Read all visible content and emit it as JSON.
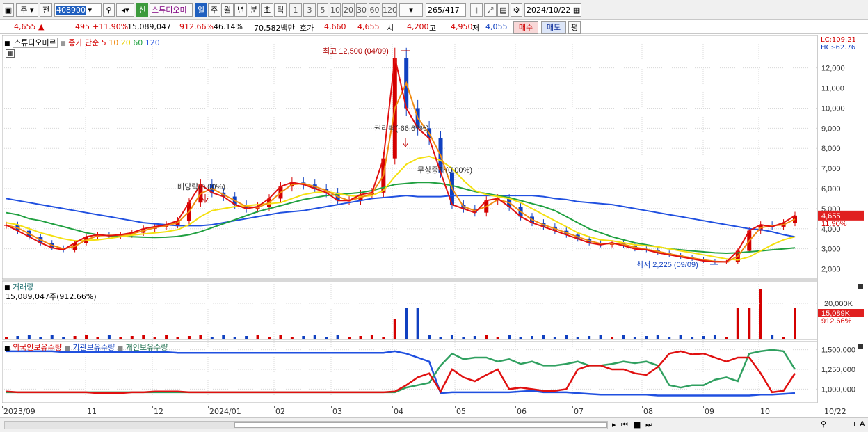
{
  "toolbar": {
    "market": "주",
    "prev": "전",
    "code": "408900",
    "badge": "신",
    "stock_name": "스튜디오미",
    "periods": [
      "일",
      "주",
      "월",
      "년",
      "분",
      "초",
      "틱"
    ],
    "selected_period": "일",
    "numbers": [
      "1",
      "3",
      "5",
      "10",
      "20",
      "30",
      "60",
      "120"
    ],
    "count": "265",
    "count_total": "/417",
    "date": "2024/10/22"
  },
  "info": {
    "price": "4,655",
    "change": "495",
    "change_pct": "+11.90%",
    "volume": "15,089,047",
    "volume_pct": "912.66%",
    "turnover": "46.14%",
    "amount": "70,582백만",
    "ask_label": "호가",
    "ask1": "4,660",
    "ask2": "4,655",
    "open_label": "시",
    "open": "4,200",
    "high_label": "고",
    "high": "4,950",
    "low_label": "저",
    "low": "4,055",
    "buy": "매수",
    "sell": "매도",
    "avg": "평"
  },
  "colors": {
    "up": "#d40000",
    "down": "#1040c0",
    "ma5": "#e01010",
    "ma10": "#f08a10",
    "ma20": "#f4e010",
    "ma60": "#20a040",
    "ma120": "#2050e0",
    "foreign": "#e01010",
    "inst": "#2050e0",
    "indiv": "#30a060"
  },
  "price_panel": {
    "name": "스튜디오미르",
    "ma_label": "종가 단순",
    "ma_periods": [
      "5",
      "10",
      "20",
      "60",
      "120"
    ],
    "lc": "LC:109.21",
    "hc": "HC:-62.76",
    "last_price_label": "4,655",
    "last_pct_label": "11.90%",
    "annotations": {
      "high": "최고 12,500 (04/09)",
      "low": "최저 2,225 (09/09)",
      "rights": "권리락(-66.67%)",
      "bonus": "무상증자(0.00%)",
      "dividend": "배당락(0.00%)"
    }
  },
  "volume_panel": {
    "title": "거래량",
    "value": "15,089,047주(912.66%)",
    "axis_label": "20,000K",
    "last_label": "15,089K",
    "last_pct": "912.66%"
  },
  "holder_panel": {
    "legend": [
      "외국인보유수량",
      "기관보유수량",
      "개인보유수량"
    ]
  },
  "x_labels": [
    "2023/09",
    "11",
    "12",
    "2024/01",
    "02",
    "03",
    "04",
    "05",
    "06",
    "07",
    "08",
    "09",
    "10",
    "10/22"
  ],
  "chart_data": {
    "type": "line",
    "y_ticks": [
      12000,
      11000,
      10000,
      9000,
      8000,
      7000,
      6000,
      5000,
      4000,
      3000,
      2000
    ],
    "ylim": [
      1500,
      13200
    ],
    "volume_ticks_label": "20,000K",
    "holder_ticks": [
      1500000,
      1250000,
      1000000
    ],
    "close": [
      4180,
      3900,
      3600,
      3300,
      3050,
      2950,
      3300,
      3600,
      3700,
      3650,
      3700,
      3800,
      4000,
      4100,
      4200,
      4400,
      5300,
      6200,
      5800,
      5600,
      5200,
      5000,
      5100,
      5500,
      6100,
      6300,
      6200,
      6000,
      5800,
      5400,
      5400,
      5700,
      5800,
      7500,
      12500,
      10000,
      9000,
      8500,
      6800,
      5200,
      5000,
      4800,
      5400,
      5500,
      5100,
      4600,
      4300,
      4100,
      3900,
      3700,
      3500,
      3300,
      3200,
      3300,
      3150,
      3000,
      2950,
      2800,
      2700,
      2600,
      2500,
      2400,
      2350,
      2350,
      2900,
      3900,
      4200,
      4100,
      4300,
      4655
    ],
    "ma20": [
      4300,
      4200,
      4000,
      3800,
      3650,
      3500,
      3400,
      3420,
      3450,
      3520,
      3600,
      3680,
      3740,
      3790,
      3850,
      3950,
      4200,
      4600,
      4900,
      5000,
      5100,
      5150,
      5200,
      5250,
      5300,
      5500,
      5700,
      5800,
      5850,
      5750,
      5650,
      5600,
      5650,
      5900,
      6600,
      7200,
      7500,
      7600,
      7400,
      7000,
      6400,
      5900,
      5700,
      5600,
      5500,
      5300,
      5000,
      4700,
      4400,
      4100,
      3800,
      3600,
      3450,
      3400,
      3300,
      3200,
      3150,
      3100,
      3000,
      2900,
      2800,
      2700,
      2600,
      2500,
      2450,
      2600,
      2900,
      3200,
      3450,
      3600
    ],
    "ma60": [
      4800,
      4700,
      4500,
      4400,
      4250,
      4100,
      3950,
      3800,
      3700,
      3650,
      3620,
      3600,
      3580,
      3570,
      3580,
      3620,
      3700,
      3850,
      4050,
      4250,
      4450,
      4650,
      4850,
      5000,
      5150,
      5300,
      5450,
      5550,
      5650,
      5700,
      5750,
      5800,
      5900,
      6050,
      6200,
      6250,
      6300,
      6300,
      6250,
      6150,
      6000,
      5850,
      5750,
      5650,
      5550,
      5400,
      5250,
      5100,
      4900,
      4600,
      4300,
      4000,
      3800,
      3600,
      3450,
      3300,
      3200,
      3100,
      3000,
      2950,
      2900,
      2850,
      2800,
      2780,
      2800,
      2850,
      2900,
      2950,
      3000,
      3050
    ],
    "ma120": [
      5500,
      5400,
      5300,
      5200,
      5100,
      5000,
      4900,
      4800,
      4700,
      4600,
      4500,
      4400,
      4300,
      4250,
      4200,
      4150,
      4150,
      4150,
      4200,
      4300,
      4400,
      4500,
      4600,
      4700,
      4800,
      4850,
      4900,
      5000,
      5100,
      5200,
      5300,
      5400,
      5500,
      5550,
      5600,
      5650,
      5600,
      5600,
      5600,
      5650,
      5650,
      5650,
      5650,
      5650,
      5650,
      5650,
      5650,
      5600,
      5500,
      5450,
      5350,
      5300,
      5250,
      5200,
      5100,
      5000,
      4900,
      4800,
      4700,
      4600,
      4500,
      4400,
      4300,
      4200,
      4100,
      4000,
      3950,
      3850,
      3700,
      3600
    ],
    "volume_spikes_idx": [
      34,
      35,
      36,
      64,
      65,
      66,
      69
    ],
    "foreign_mil": [
      0.97,
      0.96,
      0.96,
      0.96,
      0.96,
      0.96,
      0.96,
      0.96,
      0.95,
      0.95,
      0.95,
      0.96,
      0.96,
      0.97,
      0.97,
      0.97,
      0.96,
      0.96,
      0.96,
      0.96,
      0.96,
      0.96,
      0.96,
      0.96,
      0.96,
      0.96,
      0.96,
      0.96,
      0.96,
      0.96,
      0.96,
      0.96,
      0.96,
      0.96,
      0.97,
      1.05,
      1.15,
      1.2,
      0.97,
      1.25,
      1.15,
      1.1,
      1.18,
      1.25,
      1.0,
      1.02,
      1.0,
      0.98,
      0.98,
      1.0,
      1.25,
      1.3,
      1.3,
      1.25,
      1.25,
      1.2,
      1.18,
      1.28,
      1.45,
      1.48,
      1.44,
      1.45,
      1.4,
      1.35,
      1.4,
      1.4,
      1.2,
      0.96,
      0.98,
      1.2
    ],
    "inst_mil": [
      1.48,
      1.48,
      1.48,
      1.48,
      1.48,
      1.47,
      1.47,
      1.47,
      1.47,
      1.47,
      1.47,
      1.47,
      1.47,
      1.47,
      1.47,
      1.46,
      1.46,
      1.46,
      1.46,
      1.46,
      1.46,
      1.46,
      1.46,
      1.46,
      1.46,
      1.46,
      1.46,
      1.46,
      1.46,
      1.46,
      1.46,
      1.46,
      1.46,
      1.46,
      1.48,
      1.45,
      1.4,
      1.35,
      0.95,
      0.96,
      0.96,
      0.96,
      0.96,
      0.96,
      0.96,
      0.97,
      0.98,
      0.96,
      0.96,
      0.96,
      0.95,
      0.94,
      0.93,
      0.93,
      0.93,
      0.93,
      0.93,
      0.92,
      0.92,
      0.92,
      0.92,
      0.92,
      0.92,
      0.92,
      0.92,
      0.92,
      0.93,
      0.93,
      0.94,
      0.95
    ],
    "indiv_mil": [
      0.96,
      0.96,
      0.96,
      0.96,
      0.96,
      0.96,
      0.96,
      0.96,
      0.96,
      0.96,
      0.96,
      0.96,
      0.96,
      0.96,
      0.96,
      0.96,
      0.96,
      0.96,
      0.96,
      0.96,
      0.96,
      0.96,
      0.96,
      0.96,
      0.96,
      0.96,
      0.96,
      0.96,
      0.96,
      0.96,
      0.96,
      0.96,
      0.96,
      0.96,
      0.96,
      1.02,
      1.05,
      1.08,
      1.3,
      1.45,
      1.38,
      1.4,
      1.4,
      1.35,
      1.38,
      1.32,
      1.35,
      1.3,
      1.3,
      1.32,
      1.35,
      1.3,
      1.3,
      1.32,
      1.35,
      1.33,
      1.35,
      1.3,
      1.05,
      1.02,
      1.05,
      1.05,
      1.12,
      1.15,
      1.1,
      1.45,
      1.48,
      1.5,
      1.48,
      1.25
    ]
  }
}
